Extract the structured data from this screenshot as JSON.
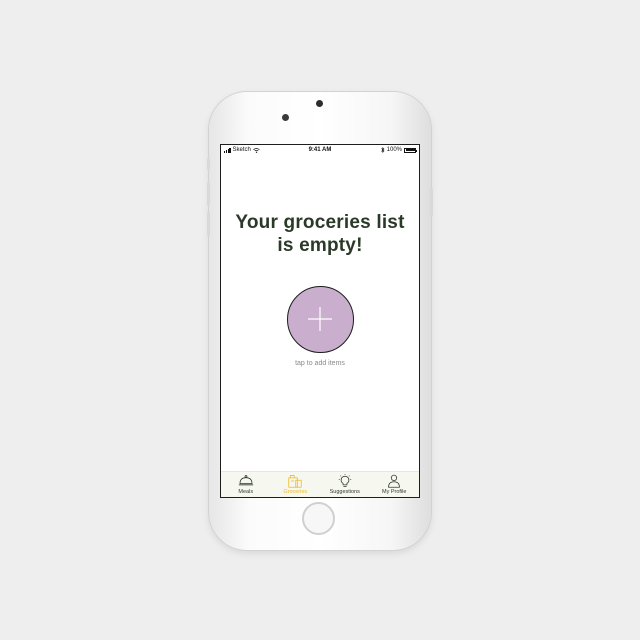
{
  "status_bar": {
    "carrier": "Sketch",
    "time": "9:41 AM",
    "battery": "100%"
  },
  "empty_state": {
    "title_line1": "Your groceries list",
    "title_line2": "is empty!",
    "add_hint": "tap to add items"
  },
  "tab_bar": {
    "items": [
      {
        "label": "Meals",
        "icon": "cloche-icon",
        "active": false
      },
      {
        "label": "Groceries",
        "icon": "grocery-bag-icon",
        "active": true
      },
      {
        "label": "Suggestions",
        "icon": "lightbulb-icon",
        "active": false
      },
      {
        "label": "My Profile",
        "icon": "person-icon",
        "active": false
      }
    ]
  },
  "colors": {
    "background": "#eeeeee",
    "title_text": "#2b3a28",
    "add_button_fill": "#c9aecd",
    "active_tab": "#f0b724",
    "tab_bar_bg": "#f6f8ef"
  }
}
